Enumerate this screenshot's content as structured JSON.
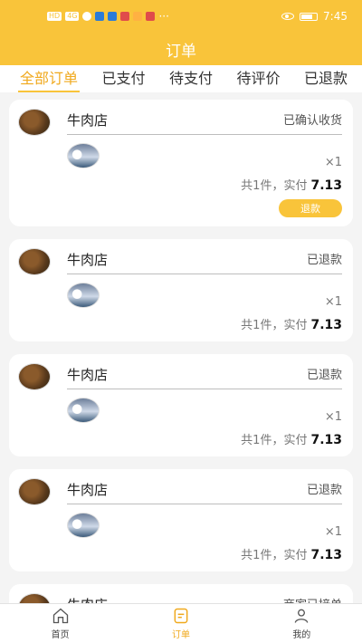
{
  "statusbar": {
    "time": "7:45",
    "left_icons": [
      "hd-icon",
      "signal-icon",
      "wifi-icon",
      "app-icon-1",
      "wechat-icon",
      "app-icon-2",
      "app-icon-3",
      "app-icon-4",
      "more-dots-icon"
    ],
    "right_icons": [
      "eye-icon",
      "battery-icon"
    ]
  },
  "header": {
    "title": "订单"
  },
  "tabs": [
    {
      "label": "全部订单",
      "active": true
    },
    {
      "label": "已支付",
      "active": false
    },
    {
      "label": "待支付",
      "active": false
    },
    {
      "label": "待评价",
      "active": false
    },
    {
      "label": "已退款",
      "active": false
    }
  ],
  "orders": [
    {
      "shop": "牛肉店",
      "status": "已确认收货",
      "qty": "×1",
      "summary_prefix": "共1件，实付",
      "amount": "7.13",
      "action": "退款"
    },
    {
      "shop": "牛肉店",
      "status": "已退款",
      "qty": "×1",
      "summary_prefix": "共1件，实付",
      "amount": "7.13"
    },
    {
      "shop": "牛肉店",
      "status": "已退款",
      "qty": "×1",
      "summary_prefix": "共1件，实付",
      "amount": "7.13"
    },
    {
      "shop": "牛肉店",
      "status": "已退款",
      "qty": "×1",
      "summary_prefix": "共1件，实付",
      "amount": "7.13"
    },
    {
      "shop": "牛肉店",
      "status": "商家已接单"
    }
  ],
  "bottomnav": [
    {
      "label": "首页",
      "icon": "home-icon",
      "active": false
    },
    {
      "label": "订单",
      "icon": "order-icon",
      "active": true
    },
    {
      "label": "我的",
      "icon": "profile-icon",
      "active": false
    }
  ],
  "colors": {
    "primary": "#f9c43a",
    "active_text": "#f0a91d"
  }
}
